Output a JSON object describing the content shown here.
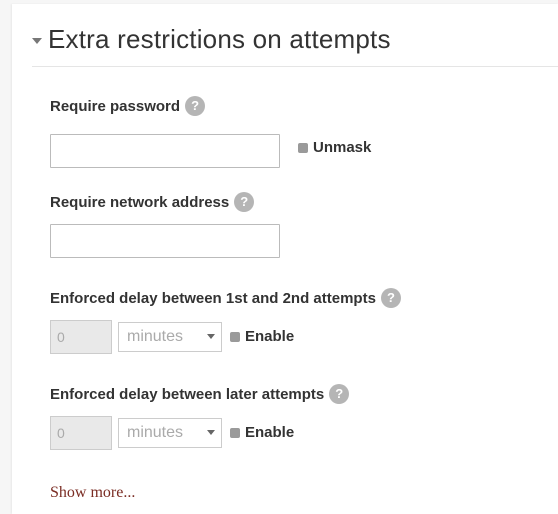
{
  "section": {
    "title": "Extra restrictions on attempts"
  },
  "fields": {
    "require_password": {
      "label": "Require password",
      "help": "?",
      "value": "",
      "unmask_label": "Unmask"
    },
    "require_network_address": {
      "label": "Require network address",
      "help": "?",
      "value": ""
    },
    "delay_1_2": {
      "label": "Enforced delay between 1st and 2nd attempts",
      "help": "?",
      "number": "0",
      "unit": "minutes",
      "enable_label": "Enable"
    },
    "delay_later": {
      "label": "Enforced delay between later attempts",
      "help": "?",
      "number": "0",
      "unit": "minutes",
      "enable_label": "Enable"
    }
  },
  "links": {
    "show_more": "Show more..."
  },
  "colors": {
    "help_icon_bg": "#b5b5b5",
    "link": "#7a2c23",
    "disabled_input_bg": "#e9e9e9"
  }
}
